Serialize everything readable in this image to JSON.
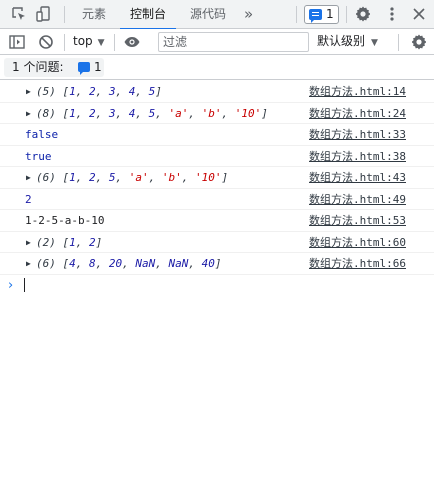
{
  "tabs": {
    "items": [
      {
        "label": "元素"
      },
      {
        "label": "控制台"
      },
      {
        "label": "源代码"
      }
    ],
    "more": "»",
    "issue_count": "1"
  },
  "toolbar": {
    "context": "top",
    "filter_placeholder": "过滤",
    "level": "默认级别"
  },
  "issues_bar": {
    "label": "1 个问题:",
    "count": "1"
  },
  "colors": {
    "accent": "#1a73e8",
    "string": "#c80000",
    "number": "#1a1aa6",
    "keyword": "#0d22aa"
  },
  "console": {
    "messages": [
      {
        "text": "(5) [1, 2, 3, 4, 5]",
        "source": "数组方法.html:14"
      },
      {
        "text": "(8) [1, 2, 3, 4, 5, 'a', 'b', '10']",
        "source": "数组方法.html:24"
      },
      {
        "text": "false",
        "source": "数组方法.html:33"
      },
      {
        "text": "true",
        "source": "数组方法.html:38"
      },
      {
        "text": "(6) [1, 2, 5, 'a', 'b', '10']",
        "source": "数组方法.html:43"
      },
      {
        "text": "2",
        "source": "数组方法.html:49"
      },
      {
        "text": "1-2-5-a-b-10",
        "source": "数组方法.html:53"
      },
      {
        "text": "(2) [1, 2]",
        "source": "数组方法.html:60"
      },
      {
        "text": "(6) [4, 8, 20, NaN, NaN, 40]",
        "source": "数组方法.html:66"
      }
    ]
  }
}
